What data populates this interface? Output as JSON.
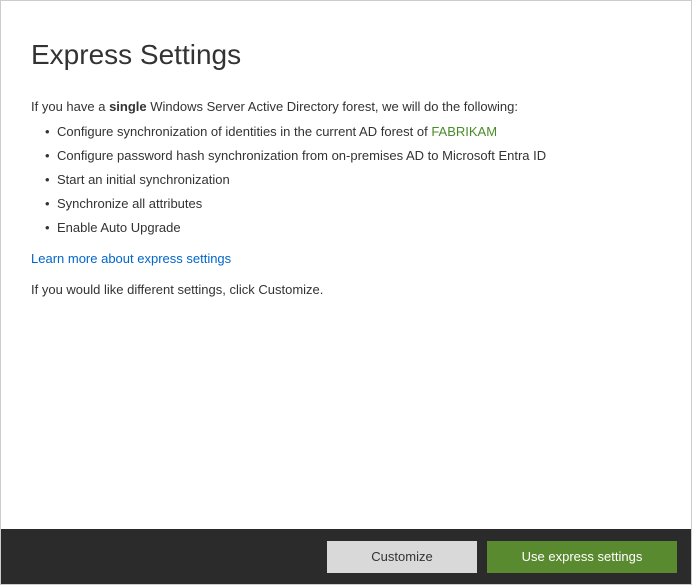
{
  "title": "Express Settings",
  "intro_prefix": "If you have a ",
  "intro_bold": "single",
  "intro_suffix": " Windows Server Active Directory forest, we will do the following:",
  "bullets": {
    "b0_prefix": "Configure synchronization of identities in the current AD forest of ",
    "b0_forest": "FABRIKAM",
    "b1": "Configure password hash synchronization from on-premises AD to Microsoft Entra ID",
    "b2": "Start an initial synchronization",
    "b3": "Synchronize all attributes",
    "b4": "Enable Auto Upgrade"
  },
  "learn_more": "Learn more about express settings",
  "customize_note": "If you would like different settings, click Customize.",
  "buttons": {
    "customize": "Customize",
    "express": "Use express settings"
  }
}
